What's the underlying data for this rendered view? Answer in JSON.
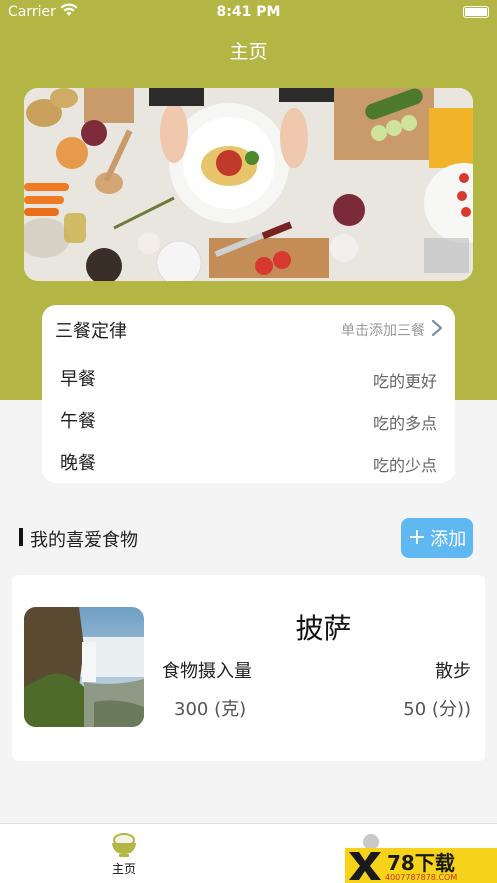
{
  "status_bar": {
    "carrier": "Carrier",
    "time": "8:41 PM"
  },
  "nav": {
    "title": "主页"
  },
  "meals": {
    "title": "三餐定律",
    "add_hint": "单击添加三餐",
    "items": [
      {
        "name": "早餐",
        "tip": "吃的更好"
      },
      {
        "name": "午餐",
        "tip": "吃的多点"
      },
      {
        "name": "晚餐",
        "tip": "吃的少点"
      }
    ]
  },
  "favorites": {
    "title": "我的喜爱食物",
    "add_button": "添加",
    "items": [
      {
        "name": "披萨",
        "intake_label": "食物摄入量",
        "intake_value": "300 (克)",
        "exercise_label": "散步",
        "exercise_value": "50 (分))"
      }
    ]
  },
  "tabbar": {
    "home_label": "主页"
  },
  "watermark": {
    "text": "78下载",
    "number": "4007787878.COM"
  },
  "colors": {
    "header": "#b3b544",
    "add_button": "#5fb8f2",
    "background": "#f4f4f4"
  }
}
